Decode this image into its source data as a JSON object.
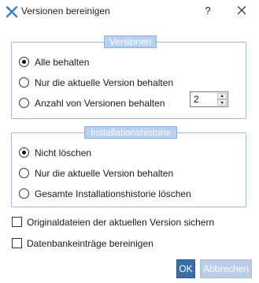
{
  "window": {
    "title": "Versionen bereinigen",
    "help_label": "?",
    "app_icon": "crossed-tools-icon",
    "close_icon": "close-icon"
  },
  "versions_group": {
    "legend": "Versionen",
    "options": [
      {
        "label": "Alle behalten",
        "checked": true
      },
      {
        "label": "Nur die aktuelle Version behalten",
        "checked": false
      },
      {
        "label": "Anzahl von Versionen behalten",
        "checked": false
      }
    ],
    "count_value": "2"
  },
  "history_group": {
    "legend": "Installationshistorie",
    "options": [
      {
        "label": "Nicht löschen",
        "checked": true
      },
      {
        "label": "Nur die aktuelle Version behalten",
        "checked": false
      },
      {
        "label": "Gesamte Installationshistorie löschen",
        "checked": false
      }
    ]
  },
  "checkboxes": [
    {
      "label": "Originaldateien der aktuellen Version sichern",
      "checked": false
    },
    {
      "label": "Datenbankeinträge bereinigen",
      "checked": false
    }
  ],
  "buttons": {
    "ok": "OK",
    "cancel": "Abbrechen"
  },
  "colors": {
    "accent": "#3a6ea8",
    "group_border": "#9fbce0",
    "legend_fill": "#b7cff0",
    "disabled_button": "#b9cde6"
  }
}
